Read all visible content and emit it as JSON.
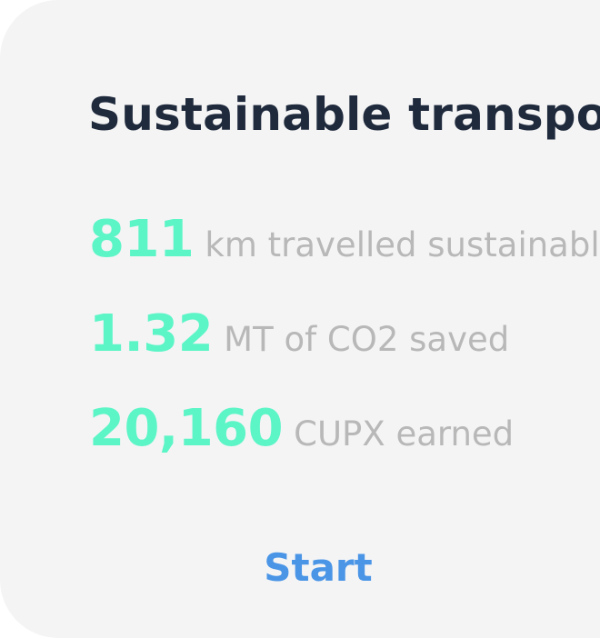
{
  "colors": {
    "accent": "#5cf5c6",
    "link": "#4a95e6",
    "title": "#1f2a3c",
    "label": "#b8b8b8",
    "card_bg": "#f4f4f5"
  },
  "card": {
    "title": "Sustainable transport",
    "stats": [
      {
        "value": "811",
        "label": "km travelled sustainably"
      },
      {
        "value": "1.32",
        "label": "MT of CO2 saved"
      },
      {
        "value": "20,160",
        "label": "CUPX earned"
      }
    ],
    "start_label": "Start"
  }
}
